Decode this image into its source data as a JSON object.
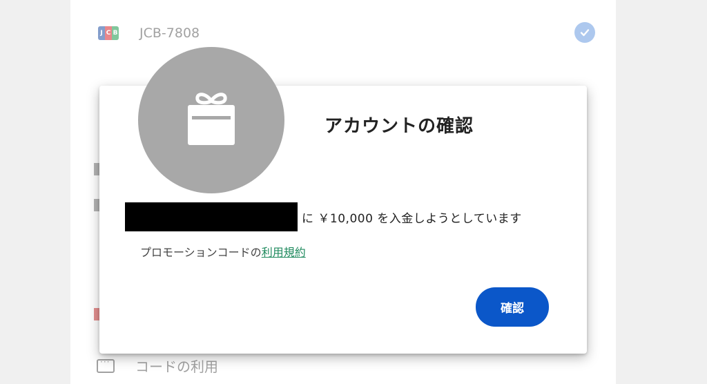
{
  "background": {
    "card_label": "JCB-7808",
    "jcb_logo_text": "JCB",
    "code_usage_label": "コードの利用"
  },
  "dialog": {
    "icon": "gift-icon",
    "title": "アカウントの確認",
    "amount_message": "に ￥10,000 を入金しようとしています",
    "promo_prefix": "プロモーションコードの",
    "terms_link": "利用規約",
    "confirm_label": "確認"
  },
  "colors": {
    "confirm_button": "#0b57c9",
    "terms_link": "#1f8a5e",
    "gift_circle": "#a8a8a8"
  }
}
